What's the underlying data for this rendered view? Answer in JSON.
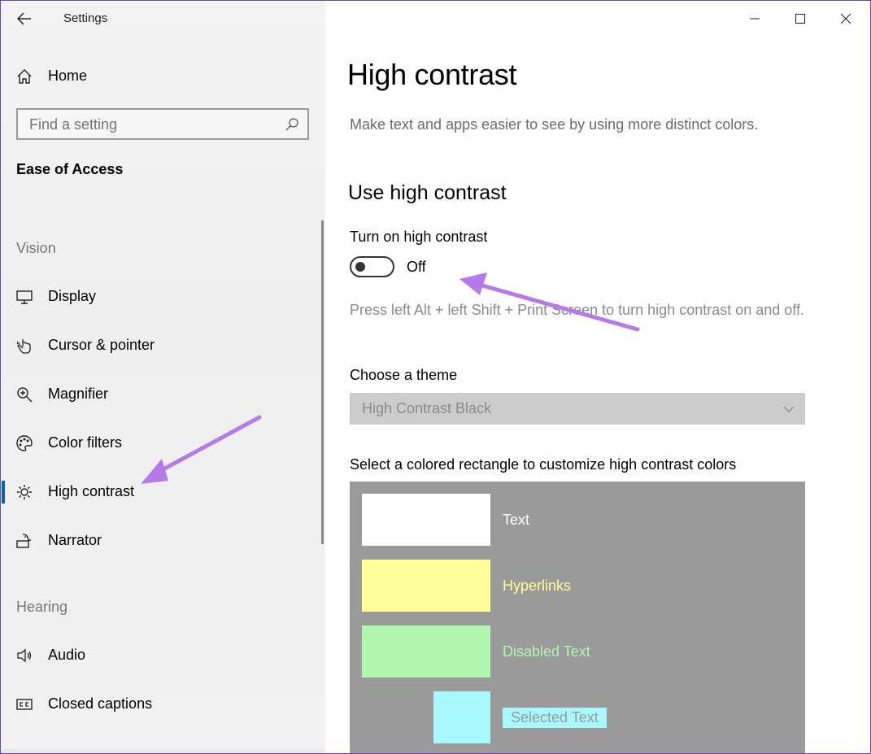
{
  "window": {
    "title": "Settings"
  },
  "sidebar": {
    "home_label": "Home",
    "search_placeholder": "Find a setting",
    "section_title": "Ease of Access",
    "groups": [
      {
        "heading": "Vision",
        "items": [
          {
            "label": "Display",
            "icon": "display-icon"
          },
          {
            "label": "Cursor & pointer",
            "icon": "cursor-icon"
          },
          {
            "label": "Magnifier",
            "icon": "magnifier-icon"
          },
          {
            "label": "Color filters",
            "icon": "palette-icon"
          },
          {
            "label": "High contrast",
            "icon": "sun-icon",
            "active": true
          },
          {
            "label": "Narrator",
            "icon": "narrator-icon"
          }
        ]
      },
      {
        "heading": "Hearing",
        "items": [
          {
            "label": "Audio",
            "icon": "speaker-icon"
          },
          {
            "label": "Closed captions",
            "icon": "cc-icon"
          }
        ]
      }
    ]
  },
  "main": {
    "page_title": "High contrast",
    "description": "Make text and apps easier to see by using more distinct colors.",
    "section_heading": "Use high contrast",
    "toggle_label": "Turn on high contrast",
    "toggle_state": "Off",
    "toggle_on": false,
    "hint": "Press left Alt + left Shift + Print Screen to turn high contrast on and off.",
    "theme_label": "Choose a theme",
    "theme_value": "High Contrast Black",
    "swatch_label": "Select a colored rectangle to customize high contrast colors",
    "swatches": [
      {
        "label": "Text",
        "color": "#ffffff",
        "text_color": "#ffffff"
      },
      {
        "label": "Hyperlinks",
        "color": "#ffff99",
        "text_color": "#ffff99"
      },
      {
        "label": "Disabled Text",
        "color": "#b0f7b0",
        "text_color": "#b0f7b0"
      },
      {
        "label": "Selected Text",
        "color": "#a8f8ff",
        "text_color": "#9a9a9a"
      }
    ]
  },
  "colors": {
    "accent": "#0063b1",
    "annotation_arrow": "#b57be8",
    "swatch_panel_bg": "#9a9a9a"
  }
}
